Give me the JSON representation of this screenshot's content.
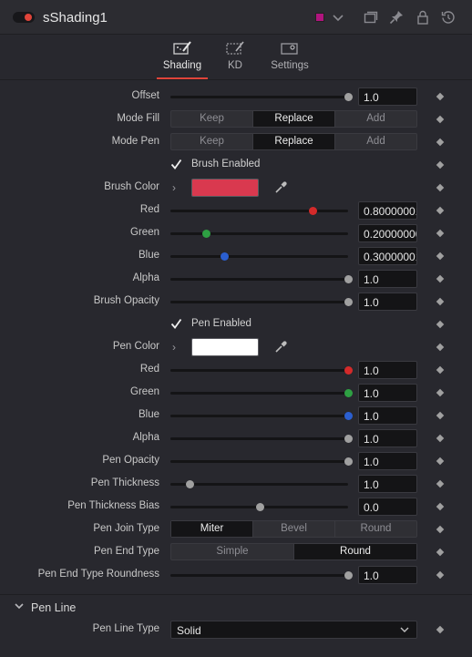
{
  "header": {
    "title": "sShading1",
    "color_swatch": "#b0157e",
    "icons": [
      "power-toggle",
      "color-chevron",
      "versions-icon",
      "pin-icon",
      "lock-icon",
      "reset-icon"
    ]
  },
  "tabs": [
    {
      "label": "Shading",
      "active": true
    },
    {
      "label": "KD",
      "active": false
    },
    {
      "label": "Settings",
      "active": false
    }
  ],
  "rows": {
    "offset": {
      "label": "Offset",
      "value": "1.0",
      "slider": 1.0
    },
    "mode_fill": {
      "label": "Mode Fill",
      "options": [
        "Keep",
        "Replace",
        "Add"
      ],
      "selected": "Replace"
    },
    "mode_pen": {
      "label": "Mode Pen",
      "options": [
        "Keep",
        "Replace",
        "Add"
      ],
      "selected": "Replace"
    },
    "brush_enabled": {
      "label": "Brush Enabled",
      "checked": true
    },
    "brush_color": {
      "label": "Brush Color",
      "color": "#d9394f"
    },
    "red": {
      "label": "Red",
      "value": "0.8000000119",
      "slider": 0.8,
      "knob_color": "#d42a2a"
    },
    "green": {
      "label": "Green",
      "value": "0.2000000030",
      "slider": 0.2,
      "knob_color": "#2ea043"
    },
    "blue": {
      "label": "Blue",
      "value": "0.3000000119",
      "slider": 0.3,
      "knob_color": "#2b5fd0"
    },
    "alpha": {
      "label": "Alpha",
      "value": "1.0",
      "slider": 1.0
    },
    "brush_opacity": {
      "label": "Brush Opacity",
      "value": "1.0",
      "slider": 1.0
    },
    "pen_enabled": {
      "label": "Pen Enabled",
      "checked": true
    },
    "pen_color": {
      "label": "Pen Color",
      "color": "#ffffff"
    },
    "pen_red": {
      "label": "Red",
      "value": "1.0",
      "slider": 1.0,
      "knob_color": "#d42a2a"
    },
    "pen_green": {
      "label": "Green",
      "value": "1.0",
      "slider": 1.0,
      "knob_color": "#2ea043"
    },
    "pen_blue": {
      "label": "Blue",
      "value": "1.0",
      "slider": 1.0,
      "knob_color": "#2b5fd0"
    },
    "pen_alpha": {
      "label": "Alpha",
      "value": "1.0",
      "slider": 1.0
    },
    "pen_opacity": {
      "label": "Pen Opacity",
      "value": "1.0",
      "slider": 1.0
    },
    "pen_thickness": {
      "label": "Pen Thickness",
      "value": "1.0",
      "slider": 0.1
    },
    "pen_thickness_bias": {
      "label": "Pen Thickness Bias",
      "value": "0.0",
      "slider": 0.5
    },
    "pen_join_type": {
      "label": "Pen Join Type",
      "options": [
        "Miter",
        "Bevel",
        "Round"
      ],
      "selected": "Miter"
    },
    "pen_end_type": {
      "label": "Pen End Type",
      "options": [
        "Simple",
        "Round"
      ],
      "selected": "Round"
    },
    "pen_end_type_roundness": {
      "label": "Pen End Type Roundness",
      "value": "1.0",
      "slider": 1.0
    }
  },
  "pen_line": {
    "section_title": "Pen Line",
    "line_type_label": "Pen Line Type",
    "line_type_value": "Solid"
  }
}
